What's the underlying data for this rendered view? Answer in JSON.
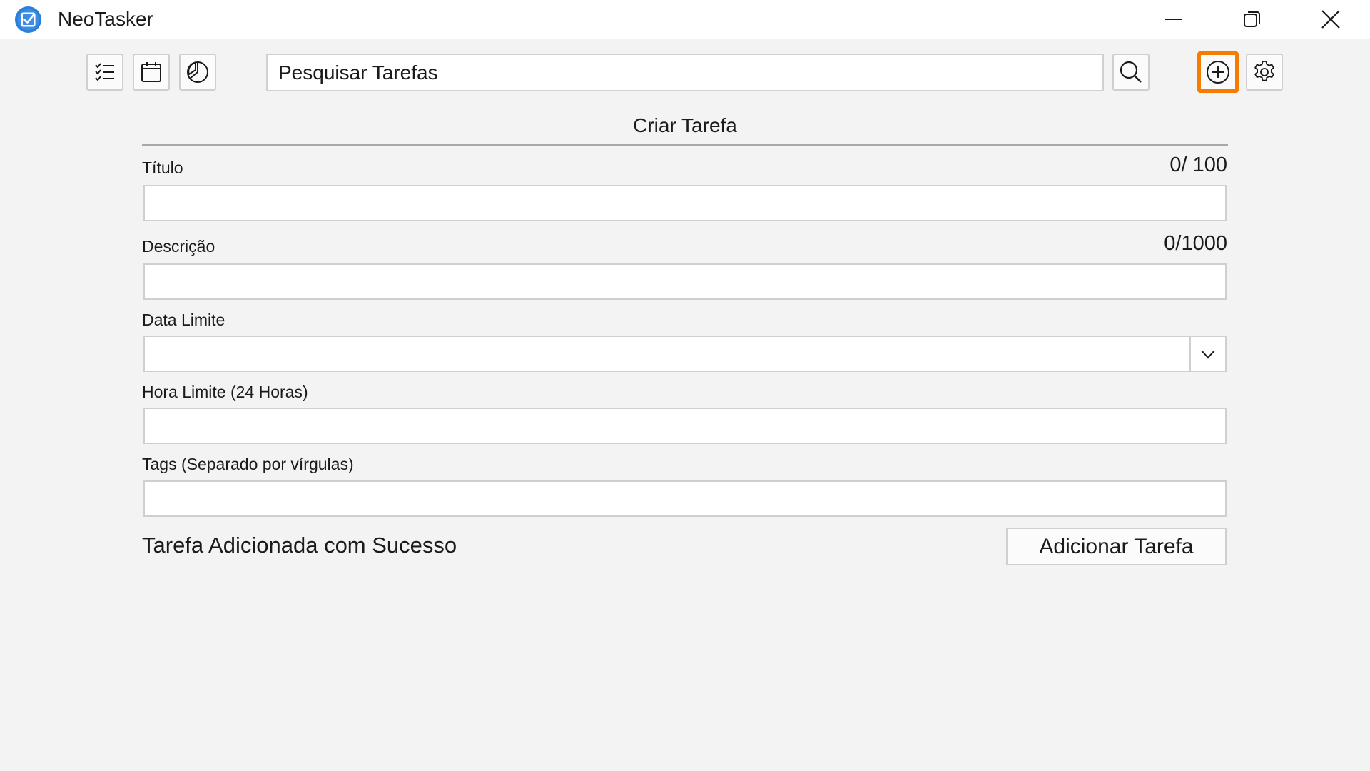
{
  "window": {
    "title": "NeoTasker",
    "controls": {
      "minimize": "minimize-icon",
      "maximize": "restore-icon",
      "close": "close-icon"
    }
  },
  "toolbar": {
    "list_icon": "task-list-icon",
    "calendar_icon": "calendar-icon",
    "chart_icon": "pie-chart-icon",
    "search_placeholder": "Pesquisar Tarefas",
    "search_value": "",
    "search_icon": "search-icon",
    "add_icon": "add-circle-icon",
    "settings_icon": "gear-icon",
    "highlight_color": "#f57c00"
  },
  "form": {
    "title": "Criar Tarefa",
    "title_field": {
      "label": "Título",
      "counter": "0/ 100",
      "value": ""
    },
    "description_field": {
      "label": "Descrição",
      "counter": "0/1000",
      "value": ""
    },
    "date_field": {
      "label": "Data Limite",
      "value": ""
    },
    "time_field": {
      "label": "Hora Limite (24 Horas)",
      "value": ""
    },
    "tags_field": {
      "label": "Tags (Separado por vírgulas)",
      "value": ""
    },
    "status_message": "Tarefa Adicionada com Sucesso",
    "submit_label": "Adicionar Tarefa"
  },
  "colors": {
    "app_icon": "#2f7fd8",
    "background": "#f3f3f3",
    "titlebar": "#ffffff"
  }
}
